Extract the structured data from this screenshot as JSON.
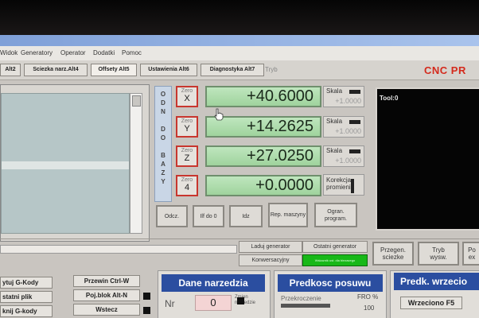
{
  "menubar": [
    "Widok",
    "Generatory",
    "Operator",
    "Dodatki",
    "Pomoc"
  ],
  "tabs": [
    "Alt2",
    "Sciezka narz.Alt4",
    "Offsety Alt5",
    "Ustawienia Alt6",
    "Diagnostyka Alt7"
  ],
  "tryb_label": "Tryb",
  "brand": "CNC PR",
  "odn_letters": [
    "O",
    "D",
    "N",
    "",
    "D",
    "O",
    "",
    "B",
    "A",
    "Z",
    "Y"
  ],
  "axes": [
    {
      "zero_label": "Zero",
      "axis": "X",
      "value": "+40.6000",
      "scale_label": "Skala",
      "scale_value": "+1.0000"
    },
    {
      "zero_label": "Zero",
      "axis": "Y",
      "value": "+14.2625",
      "scale_label": "Skala",
      "scale_value": "+1.0000"
    },
    {
      "zero_label": "Zero",
      "axis": "Z",
      "value": "+27.0250",
      "scale_label": "Skala",
      "scale_value": "+1.0000"
    },
    {
      "zero_label": "Zero",
      "axis": "4",
      "value": "+0.0000"
    }
  ],
  "korekcja": {
    "line1": "Korekcja",
    "line2": "promienia"
  },
  "bottom_buttons": [
    "Odcz.",
    "Ilf do 0",
    "Idz",
    "Rep. maszyny",
    "Ogran. program."
  ],
  "tool_panel": {
    "label": "Tool:0"
  },
  "generators": {
    "load": "Laduj generator",
    "last": "Ostatni generator",
    "conversational": "Konwersacyjny",
    "green": "Wskaznik ust. dla biezacego"
  },
  "right_buttons": [
    {
      "l1": "Przegen.",
      "l2": "sciezke"
    },
    {
      "l1": "Tryb",
      "l2": "wysw."
    },
    {
      "l1": "Po",
      "l2": "ex"
    }
  ],
  "gcode_buttons": [
    "ytuj G-Kody",
    "statni plik",
    "knij G-kody"
  ],
  "block_buttons": [
    "Przewin Ctrl-W",
    "Poj.blok Alt-N",
    "Wstecz"
  ],
  "tool_data": {
    "title": "Dane narzedzia",
    "nr_label": "Nr",
    "nr_value": "0",
    "zmien_label": "Zmien narzedzie"
  },
  "feed": {
    "title": "Predkosc posuwu",
    "override_label": "Przekroczenie",
    "fro_label": "FRO %",
    "fro_value": "100"
  },
  "spindle": {
    "title": "Predk. wrzecio",
    "button": "Wrzeciono F5"
  }
}
